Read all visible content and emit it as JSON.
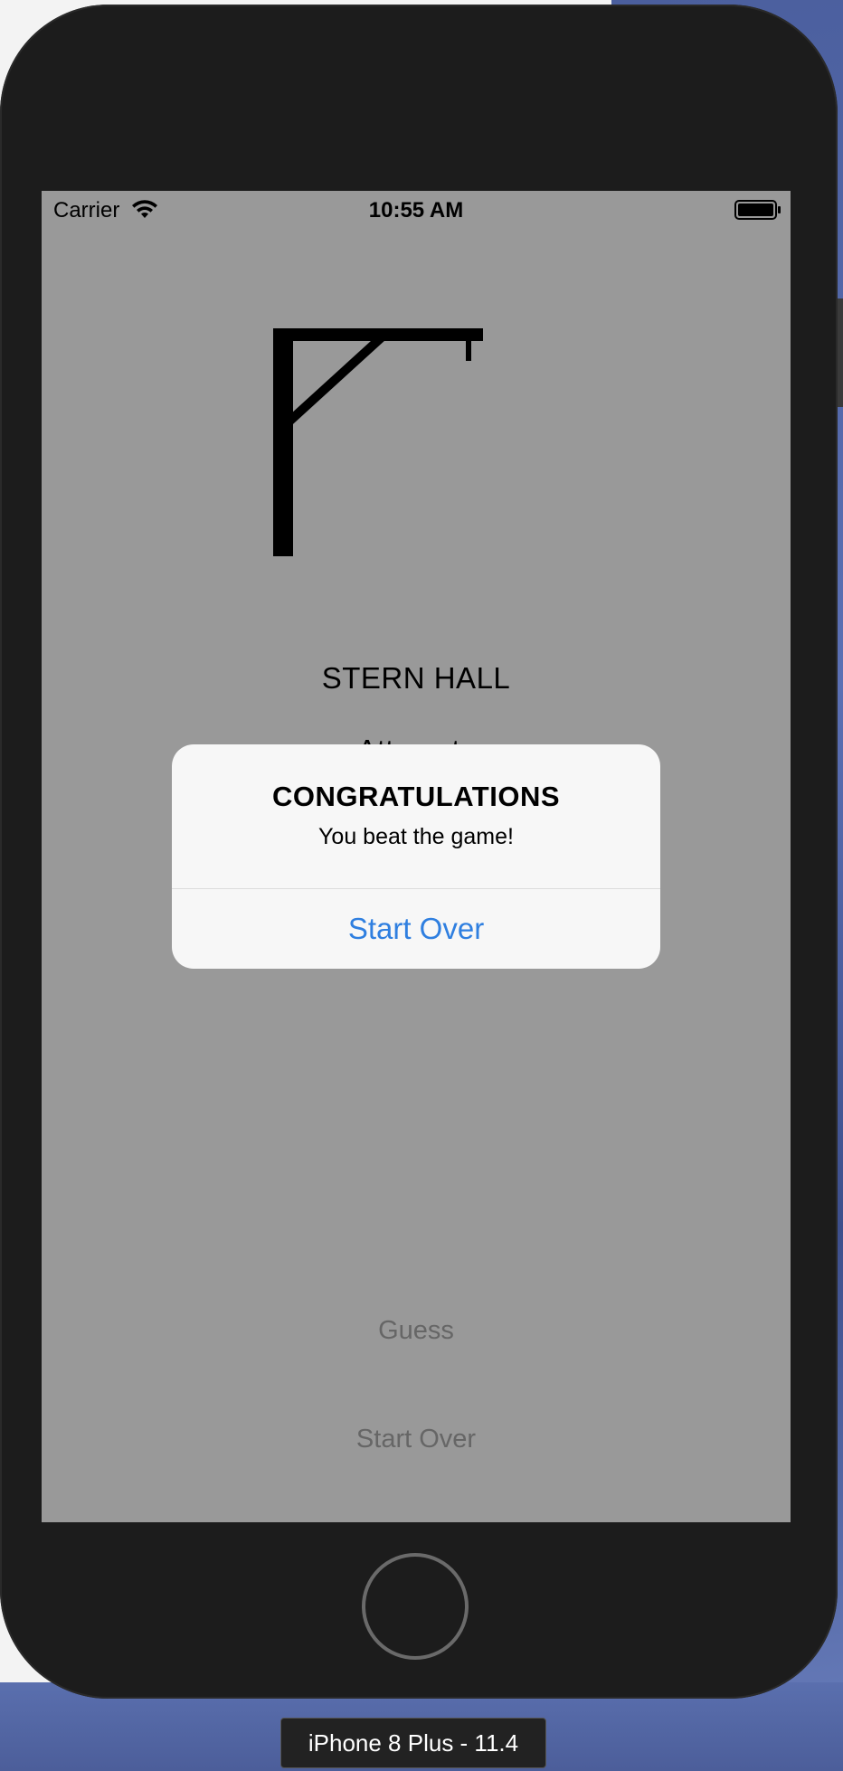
{
  "status_bar": {
    "carrier": "Carrier",
    "time": "10:55 AM"
  },
  "game": {
    "word": "STERN HALL",
    "attempts_label": "Attempts"
  },
  "buttons": {
    "guess_label": "Guess",
    "start_over_label": "Start Over"
  },
  "alert": {
    "title": "CONGRATULATIONS",
    "message": "You beat the game!",
    "action_label": "Start Over",
    "action_color": "#2f7fe0"
  },
  "simulator": {
    "device_name": "iPhone 8 Plus - 11.4"
  },
  "icons": {
    "wifi": "wifi-icon",
    "battery": "battery-icon",
    "gallows": "gallows-icon"
  }
}
